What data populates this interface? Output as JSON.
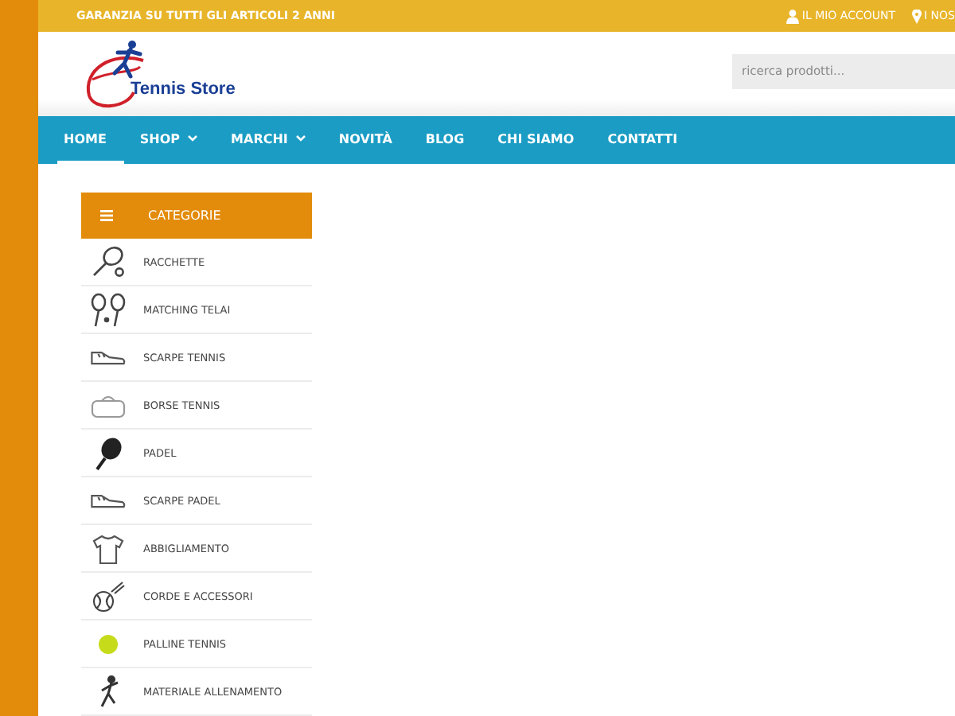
{
  "top_bar": {
    "notice": "GARANZIA SU TUTTI GLI ARTICOLI 2 ANNI",
    "links": [
      {
        "kind": "account",
        "label": "IL MIO ACCOUNT"
      },
      {
        "kind": "location",
        "label": "I NOS"
      }
    ]
  },
  "header": {
    "logo_text": "Tennis Store",
    "search": {
      "placeholder": "ricerca prodotti..."
    }
  },
  "nav": [
    {
      "label": "HOME",
      "selected": true,
      "dropdown": false
    },
    {
      "label": "SHOP",
      "selected": false,
      "dropdown": true
    },
    {
      "label": "MARCHI",
      "selected": false,
      "dropdown": true
    },
    {
      "label": "NOVITÀ",
      "selected": false,
      "dropdown": false
    },
    {
      "label": "BLOG",
      "selected": false,
      "dropdown": false
    },
    {
      "label": "CHI SIAMO",
      "selected": false,
      "dropdown": false
    },
    {
      "label": "CONTATTI",
      "selected": false,
      "dropdown": false
    }
  ],
  "categories": {
    "title": "CATEGORIE",
    "items": [
      {
        "label": "RACCHETTE",
        "kind": "racket"
      },
      {
        "label": "MATCHING TELAI",
        "kind": "rackets"
      },
      {
        "label": "SCARPE TENNIS",
        "kind": "shoe"
      },
      {
        "label": "BORSE TENNIS",
        "kind": "bag"
      },
      {
        "label": "PADEL",
        "kind": "paddle"
      },
      {
        "label": "SCARPE PADEL",
        "kind": "shoe"
      },
      {
        "label": "ABBIGLIAMENTO",
        "kind": "shirt"
      },
      {
        "label": "CORDE E ACCESSORI",
        "kind": "strings"
      },
      {
        "label": "PALLINE TENNIS",
        "kind": "ball"
      },
      {
        "label": "MATERIALE ALLENAMENTO",
        "kind": "player"
      }
    ]
  }
}
